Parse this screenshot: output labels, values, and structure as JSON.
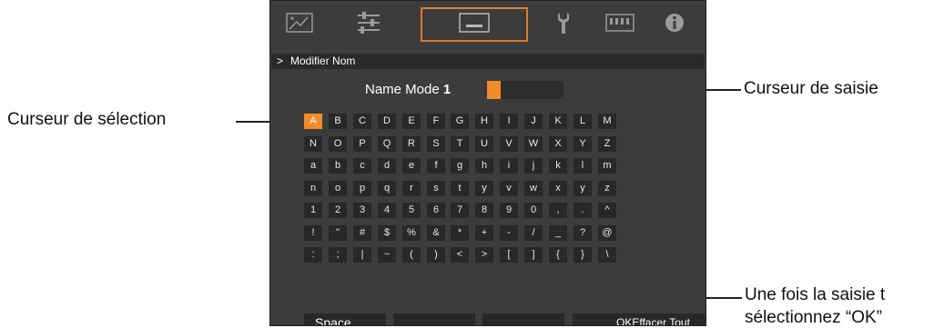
{
  "menu": {
    "breadcrumb_arrow": ">",
    "title": "Modifier Nom",
    "icons": [
      "picture-adjust-icon",
      "sliders-icon",
      "input-signal-icon",
      "wrench-icon",
      "film-strip-icon",
      "info-icon"
    ],
    "selected_tab_index": 2
  },
  "mode": {
    "label": "Name Mode",
    "number": "1"
  },
  "keyboard": {
    "rows": [
      [
        "A",
        "B",
        "C",
        "D",
        "E",
        "F",
        "G",
        "H",
        "I",
        "J",
        "K",
        "L",
        "M"
      ],
      [
        "N",
        "O",
        "P",
        "Q",
        "R",
        "S",
        "T",
        "U",
        "V",
        "W",
        "X",
        "Y",
        "Z"
      ],
      [
        "a",
        "b",
        "c",
        "d",
        "e",
        "f",
        "g",
        "h",
        "i",
        "j",
        "k",
        "l",
        "m"
      ],
      [
        "n",
        "o",
        "p",
        "q",
        "r",
        "s",
        "t",
        "y",
        "v",
        "w",
        "x",
        "y",
        "z"
      ],
      [
        "1",
        "2",
        "3",
        "4",
        "5",
        "6",
        "7",
        "8",
        "9",
        "0",
        ",",
        ".",
        "^"
      ],
      [
        "!",
        "\"",
        "#",
        "$",
        "%",
        "&",
        "*",
        "+",
        "-",
        "/",
        "_",
        "?",
        "@"
      ],
      [
        ":",
        ";",
        "|",
        "~",
        "(",
        ")",
        "<",
        ">",
        "[",
        "]",
        "{",
        "}",
        "\\"
      ]
    ],
    "selected_key": "A",
    "bottom_keys": {
      "space": "Space",
      "ok": "OK",
      "clear": "Effacer Tout"
    }
  },
  "annotations": {
    "input_cursor": "Curseur de saisie",
    "selection_cursor": "Curseur de sélection",
    "ok_note_line1": "Une fois la saisie t",
    "ok_note_line2": "sélectionnez “OK”"
  },
  "colors": {
    "accent": "#f08c2a",
    "panel": "#3c3c3c",
    "key": "#282828"
  }
}
